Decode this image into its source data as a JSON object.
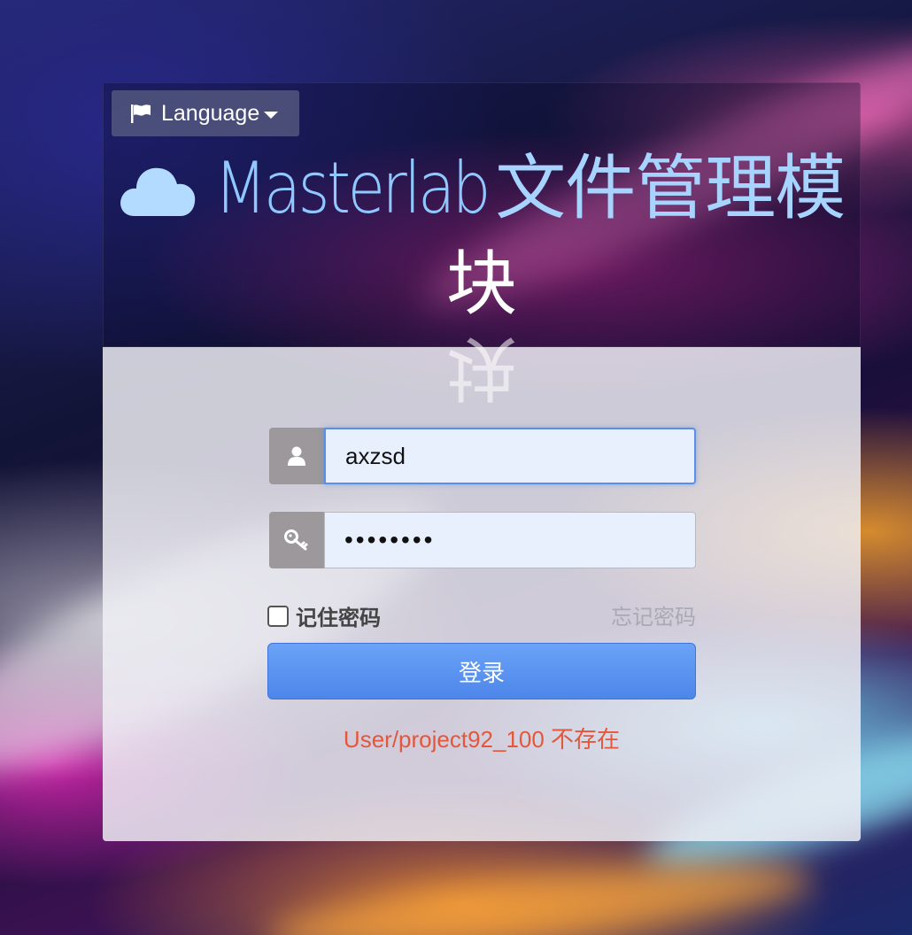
{
  "language_button": {
    "label": "Language"
  },
  "title": {
    "latin": "Masterlab",
    "cjk": "文件管理模",
    "line2": "块"
  },
  "login_form": {
    "username_value": "axzsd",
    "password_value": "••••••••",
    "remember_label": "记住密码",
    "forgot_label": "忘记密码",
    "login_label": "登录",
    "error_message": "User/project92_100 不存在"
  },
  "icons": [
    "flag-icon",
    "caret-down-icon",
    "cloud-icon",
    "user-icon",
    "key-icon"
  ],
  "colors": {
    "title_latin": "#8fc8ff",
    "title_cjk": "#a6d4ff",
    "login_button": "#5a93f0",
    "error": "#e4573a",
    "addon": "#9c989c",
    "input_bg": "#e8f0fe"
  }
}
